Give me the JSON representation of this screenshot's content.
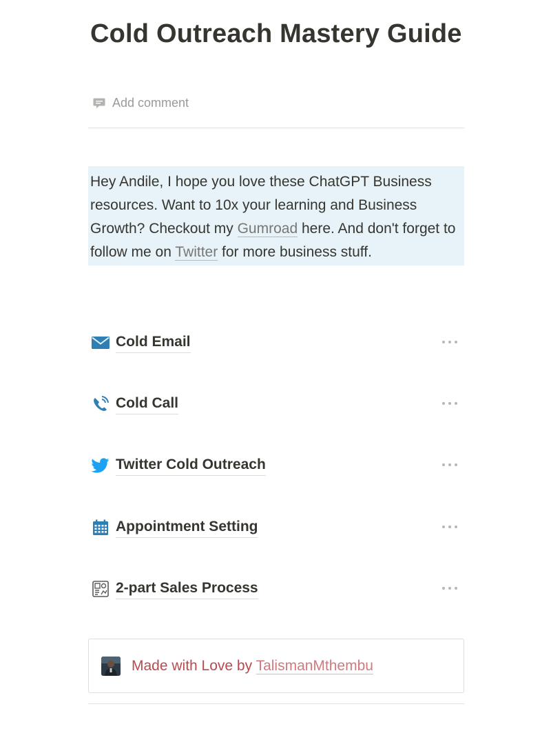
{
  "page": {
    "title": "Cold Outreach Mastery Guide",
    "add_comment": "Add comment"
  },
  "callout": {
    "text_1": "Hey Andile, I hope you love these ChatGPT Business resources. Want to 10x your learning and Business Growth? Checkout my ",
    "link_gumroad": "Gumroad",
    "text_2": " here. And don't forget to follow me on ",
    "link_twitter": "Twitter",
    "text_3": " for more business stuff.",
    "background": "#e7f3f8"
  },
  "pages": [
    {
      "label": "Cold Email",
      "icon": "envelope-icon"
    },
    {
      "label": "Cold Call",
      "icon": "phone-icon"
    },
    {
      "label": "Twitter Cold Outreach",
      "icon": "twitter-bird-icon"
    },
    {
      "label": "Appointment Setting",
      "icon": "calendar-icon"
    },
    {
      "label": "2-part Sales Process",
      "icon": "sales-process-icon"
    }
  ],
  "footer": {
    "text": "Made with Love by ",
    "link": "TalismanMthembu",
    "text_color": "#b84a50"
  },
  "colors": {
    "text": "#37352f",
    "muted": "#9b9a97",
    "icon_blue": "#2f7fb5"
  }
}
